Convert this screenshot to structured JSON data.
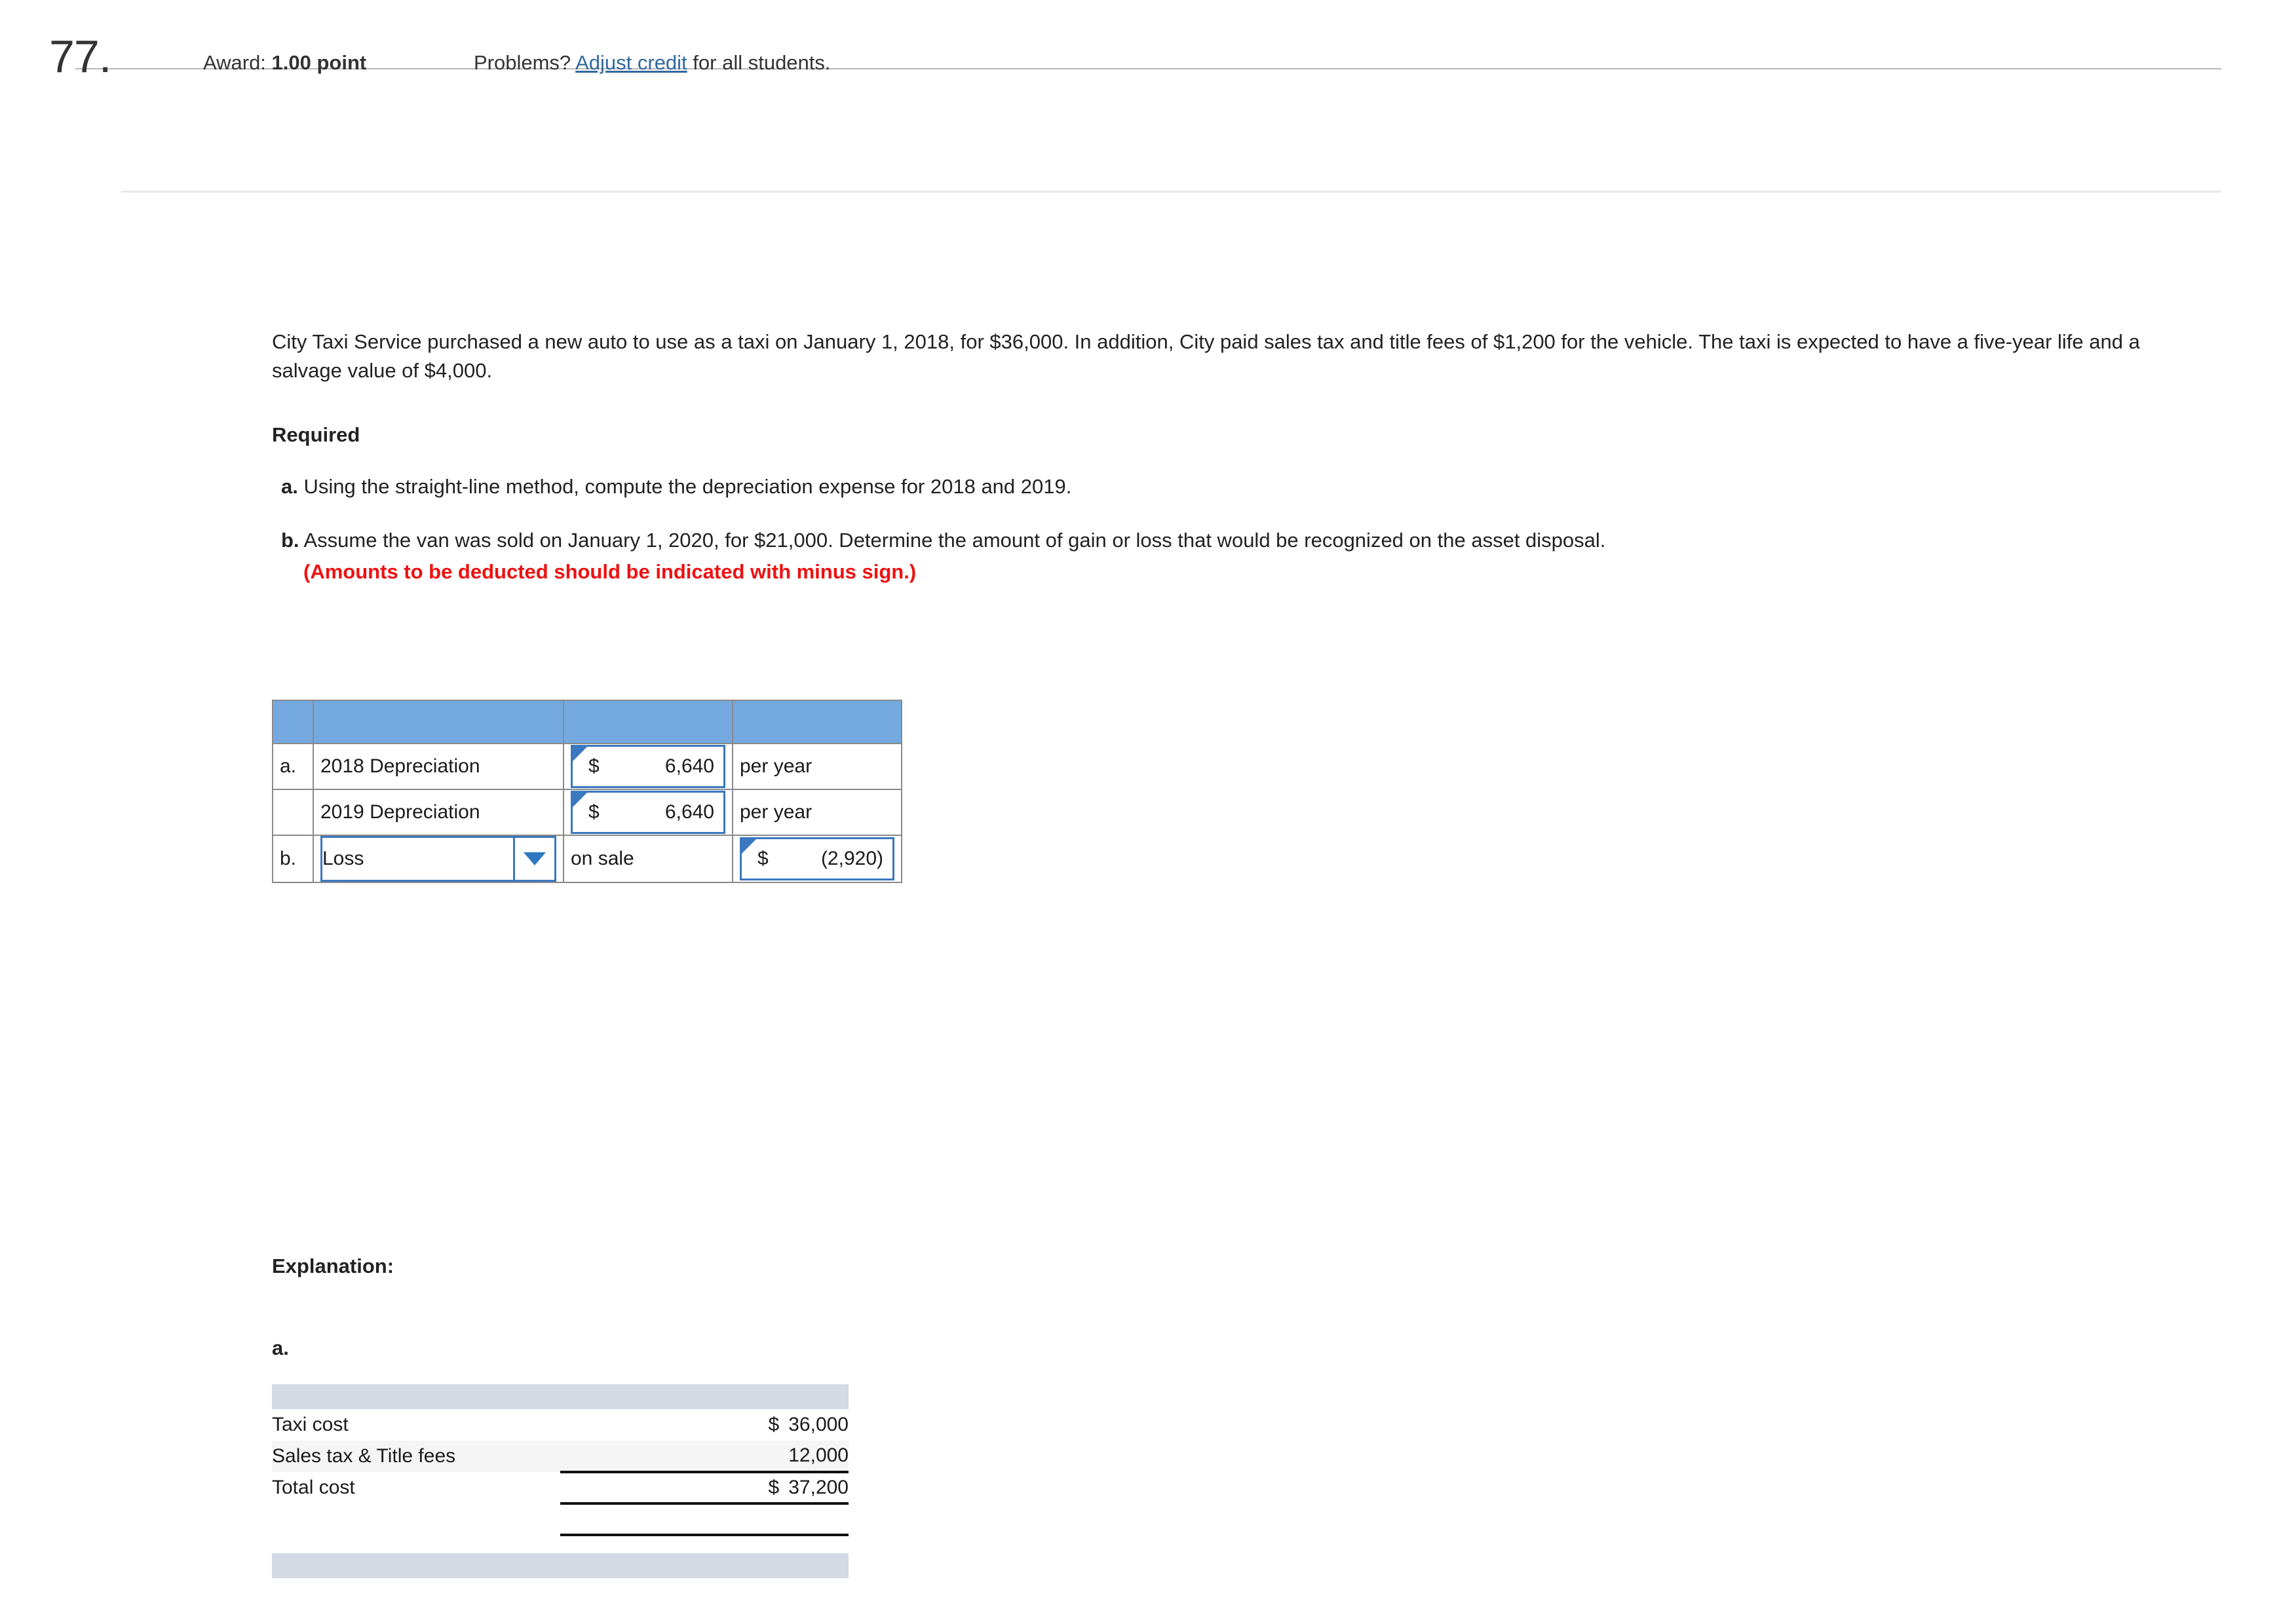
{
  "header": {
    "question_number": "77.",
    "award_label": "Award:",
    "award_value": "1.00 point",
    "problems_prefix": "Problems?",
    "adjust_link": "Adjust credit",
    "problems_suffix": "for all students."
  },
  "problem": {
    "text": "City Taxi Service purchased a new auto to use as a taxi on January 1, 2018, for $36,000. In addition, City paid sales tax and title fees of $1,200 for the vehicle. The taxi is expected to have a five-year life and a salvage value of $4,000.",
    "required_heading": "Required",
    "requirements": [
      {
        "letter": "a.",
        "text": "Using the straight-line method, compute the depreciation expense for 2018 and 2019.",
        "note": ""
      },
      {
        "letter": "b.",
        "text": "Assume the van was sold on January 1, 2020, for $21,000. Determine the amount of gain or loss that would be recognized on the asset disposal.",
        "note": "(Amounts to be deducted should be indicated with minus sign.)"
      }
    ]
  },
  "answer_table": {
    "header_color": "#74a9e0",
    "rows": [
      {
        "letter": "a.",
        "label": "2018 Depreciation",
        "amount_symbol": "$",
        "amount_value": "6,640",
        "unit": "per year",
        "type": "amount"
      },
      {
        "letter": "",
        "label": "2019 Depreciation",
        "amount_symbol": "$",
        "amount_value": "6,640",
        "unit": "per year",
        "type": "amount"
      },
      {
        "letter": "b.",
        "select_value": "Loss",
        "unit": "on sale",
        "amount_symbol": "$",
        "amount_value": "(2,920)",
        "type": "select"
      }
    ]
  },
  "explanation": {
    "heading": "Explanation:",
    "part_letter": "a.",
    "cost_table": {
      "band_color": "#d4d9e3",
      "rows": [
        {
          "name": "Taxi cost",
          "symbol": "$",
          "value": "36,000"
        },
        {
          "name": "Sales tax & Title fees",
          "symbol": "",
          "value": "12,000"
        },
        {
          "name": "Total cost",
          "symbol": "$",
          "value": "37,200"
        }
      ]
    }
  }
}
